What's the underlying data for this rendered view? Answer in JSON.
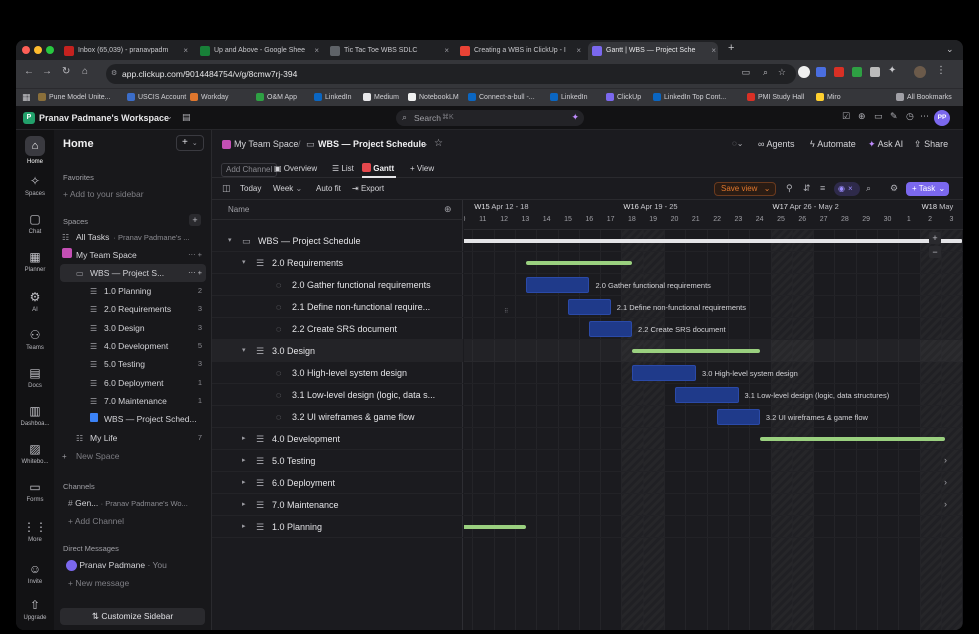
{
  "browser": {
    "tabs": [
      {
        "label": "Inbox (65,039) - pranavpadm",
        "color": "#c5221f"
      },
      {
        "label": "Up and Above - Google Shee",
        "color": "#188038"
      },
      {
        "label": "Tic Tac Toe WBS SDLC",
        "color": "#5f6368"
      },
      {
        "label": "Creating a WBS in ClickUp - I",
        "color": "#ea4335"
      },
      {
        "label": "Gantt | WBS — Project Sche",
        "color": "#7b68ee"
      }
    ],
    "url": "app.clickup.com/9014484754/v/g/8cmw7rj-394",
    "bookmarks": [
      "Pune Model Unite...",
      "USCIS Account",
      "Workday",
      "O&M App",
      "LinkedIn",
      "Medium",
      "NotebookLM",
      "Connect-a-bull -...",
      "LinkedIn",
      "ClickUp",
      "LinkedIn Top Cont...",
      "PMI Study Hall",
      "Miro"
    ],
    "all_bookmarks": "All Bookmarks",
    "avatar": "PP"
  },
  "app": {
    "workspace": "Pranav Padmane's Workspace",
    "workspace_initial": "P",
    "search_placeholder": "Search",
    "search_shortcut": "⌘K",
    "avatar": "PP"
  },
  "rail": [
    "Home",
    "Spaces",
    "Chat",
    "Planner",
    "AI",
    "Teams",
    "Docs",
    "Dashboa...",
    "Whitebo...",
    "Forms",
    "More",
    "Invite",
    "Upgrade"
  ],
  "sidebar": {
    "title": "Home",
    "favorites_label": "Favorites",
    "add_favorite": "Add to your sidebar",
    "spaces_label": "Spaces",
    "all_tasks": "All Tasks",
    "all_tasks_sub": "· Pranav Padmane's ...",
    "team_space": "My Team Space",
    "wbs_folder": "WBS — Project S...",
    "lists": [
      {
        "name": "1.0 Planning",
        "count": "2"
      },
      {
        "name": "2.0 Requirements",
        "count": "3"
      },
      {
        "name": "3.0 Design",
        "count": "3"
      },
      {
        "name": "4.0 Development",
        "count": "5"
      },
      {
        "name": "5.0 Testing",
        "count": "3"
      },
      {
        "name": "6.0 Deployment",
        "count": "1"
      },
      {
        "name": "7.0 Maintenance",
        "count": "1"
      }
    ],
    "wbs_doc": "WBS — Project Sched...",
    "my_life": "My Life",
    "my_life_count": "7",
    "new_space": "New Space",
    "channels_label": "Channels",
    "channel_name": "Gen...",
    "channel_sub": "· Pranav Padmane's Wo...",
    "add_channel": "Add Channel",
    "dm_label": "Direct Messages",
    "dm_user": "Pranav Padmane",
    "dm_you": "· You",
    "new_message": "New message",
    "customize": "Customize Sidebar"
  },
  "main": {
    "breadcrumb_space": "My Team Space",
    "breadcrumb_sep": "/",
    "breadcrumb_folder": "WBS — Project Schedule",
    "agents": "Agents",
    "automate": "Automate",
    "ask_ai": "Ask AI",
    "share": "Share",
    "views": {
      "add_channel": "Add Channel",
      "overview": "Overview",
      "list": "List",
      "gantt": "Gantt",
      "add_view": "View"
    },
    "toolbar": {
      "today": "Today",
      "week": "Week",
      "autofit": "Auto fit",
      "export": "Export",
      "save_view": "Save view",
      "task": "Task"
    },
    "col_name": "Name",
    "tree": [
      {
        "label": "WBS — Project Schedule",
        "level": 0,
        "kind": "folder",
        "open": true
      },
      {
        "label": "2.0 Requirements",
        "level": 1,
        "kind": "list",
        "open": true
      },
      {
        "label": "2.0 Gather functional requirements",
        "level": 2,
        "kind": "task"
      },
      {
        "label": "2.1 Define non-functional require...",
        "level": 2,
        "kind": "task"
      },
      {
        "label": "2.2 Create SRS document",
        "level": 2,
        "kind": "task"
      },
      {
        "label": "3.0 Design",
        "level": 1,
        "kind": "list",
        "open": true
      },
      {
        "label": "3.0 High-level system design",
        "level": 2,
        "kind": "task"
      },
      {
        "label": "3.1 Low-level design (logic, data s...",
        "level": 2,
        "kind": "task"
      },
      {
        "label": "3.2 UI wireframes & game flow",
        "level": 2,
        "kind": "task"
      },
      {
        "label": "4.0 Development",
        "level": 1,
        "kind": "list",
        "open": false
      },
      {
        "label": "5.0 Testing",
        "level": 1,
        "kind": "list",
        "open": false
      },
      {
        "label": "6.0 Deployment",
        "level": 1,
        "kind": "list",
        "open": false
      },
      {
        "label": "7.0 Maintenance",
        "level": 1,
        "kind": "list",
        "open": false
      },
      {
        "label": "1.0 Planning",
        "level": 1,
        "kind": "list",
        "open": false
      }
    ],
    "weeks": [
      {
        "label": "W15",
        "range": "Apr 12 - 18",
        "day_index": 1
      },
      {
        "label": "W16",
        "range": "Apr 19 - 25",
        "day_index": 8
      },
      {
        "label": "W17",
        "range": "Apr 26 - May 2",
        "day_index": 15
      },
      {
        "label": "W18",
        "range": "May",
        "day_index": 22
      }
    ],
    "days": [
      "10",
      "11",
      "12",
      "13",
      "14",
      "15",
      "16",
      "17",
      "18",
      "19",
      "20",
      "21",
      "22",
      "23",
      "24",
      "25",
      "26",
      "27",
      "28",
      "29",
      "30",
      "1",
      "2",
      "3"
    ],
    "weekend_days": [
      8,
      9,
      15,
      16,
      22,
      23
    ],
    "bars": [
      {
        "row": 0,
        "start": -1,
        "end": 24,
        "kind": "folder",
        "label": ""
      },
      {
        "row": 1,
        "start": 3.5,
        "end": 8.5,
        "kind": "summary",
        "label": ""
      },
      {
        "row": 2,
        "start": 3.5,
        "end": 6.5,
        "kind": "task",
        "label": "2.0 Gather functional requirements"
      },
      {
        "row": 3,
        "start": 5.5,
        "end": 7.5,
        "kind": "task",
        "label": "2.1 Define non-functional requirements"
      },
      {
        "row": 4,
        "start": 6.5,
        "end": 8.5,
        "kind": "task",
        "label": "2.2 Create SRS document"
      },
      {
        "row": 5,
        "start": 8.5,
        "end": 14.5,
        "kind": "summary",
        "label": ""
      },
      {
        "row": 6,
        "start": 8.5,
        "end": 11.5,
        "kind": "task",
        "label": "3.0 High-level system design"
      },
      {
        "row": 7,
        "start": 10.5,
        "end": 13.5,
        "kind": "task",
        "label": "3.1 Low-level design (logic, data structures)"
      },
      {
        "row": 8,
        "start": 12.5,
        "end": 14.5,
        "kind": "task",
        "label": "3.2 UI wireframes & game flow"
      },
      {
        "row": 9,
        "start": 14.5,
        "end": 23.2,
        "kind": "summary",
        "label": ""
      },
      {
        "row": 13,
        "start": -1,
        "end": 3.5,
        "kind": "summary",
        "label": ""
      }
    ],
    "more_rows": [
      10,
      11,
      12
    ]
  },
  "colors": {
    "accent": "#7b68ee",
    "summary": "#9ad07f",
    "task": "#1f3a8a",
    "save_view": "#e0772d"
  }
}
